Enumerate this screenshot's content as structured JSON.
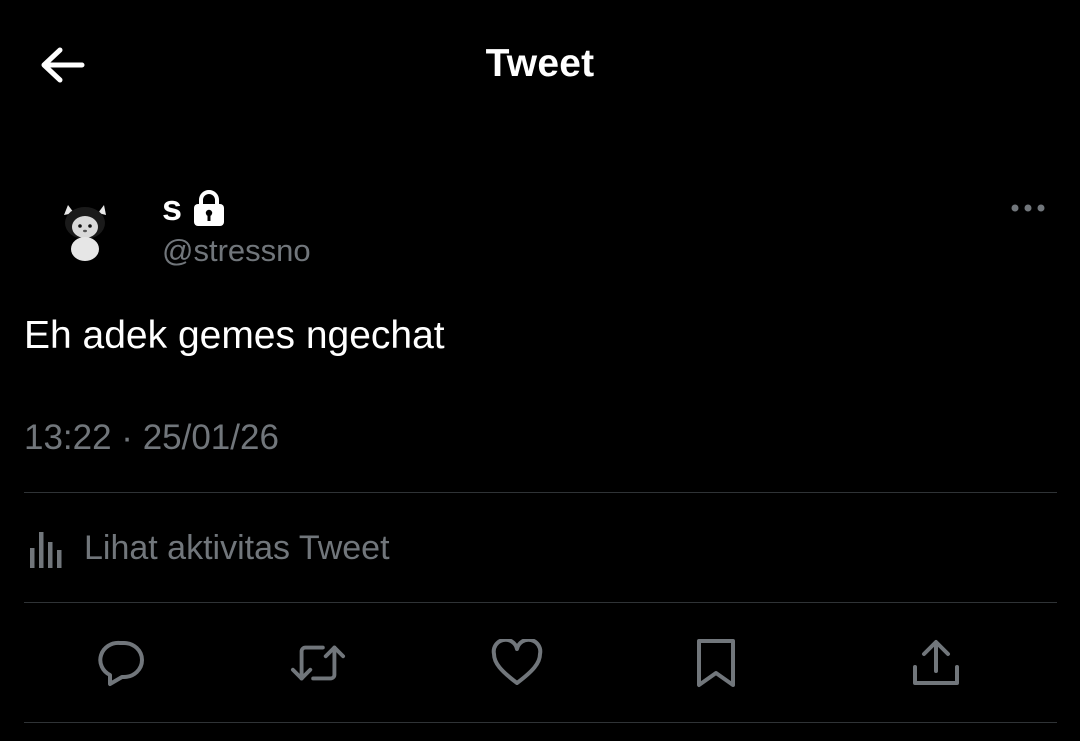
{
  "header": {
    "title": "Tweet",
    "back_icon": "arrow-left-icon"
  },
  "author": {
    "display_name": "s",
    "username": "@stressno",
    "protected_icon": "lock-icon",
    "avatar": "avatar-image"
  },
  "tweet": {
    "text": "Eh adek gemes ngechat",
    "timestamp": "13:22 · 25/01/26"
  },
  "activity": {
    "label": "Lihat aktivitas Tweet",
    "icon": "bar-chart-icon"
  },
  "actions": [
    {
      "name": "reply",
      "icon": "reply-icon"
    },
    {
      "name": "retweet",
      "icon": "retweet-icon"
    },
    {
      "name": "like",
      "icon": "heart-icon"
    },
    {
      "name": "bookmark",
      "icon": "bookmark-icon"
    },
    {
      "name": "share",
      "icon": "share-icon"
    }
  ],
  "colors": {
    "background": "#000000",
    "primary_text": "#ffffff",
    "secondary_text": "#71767b",
    "divider": "#2f3336"
  }
}
